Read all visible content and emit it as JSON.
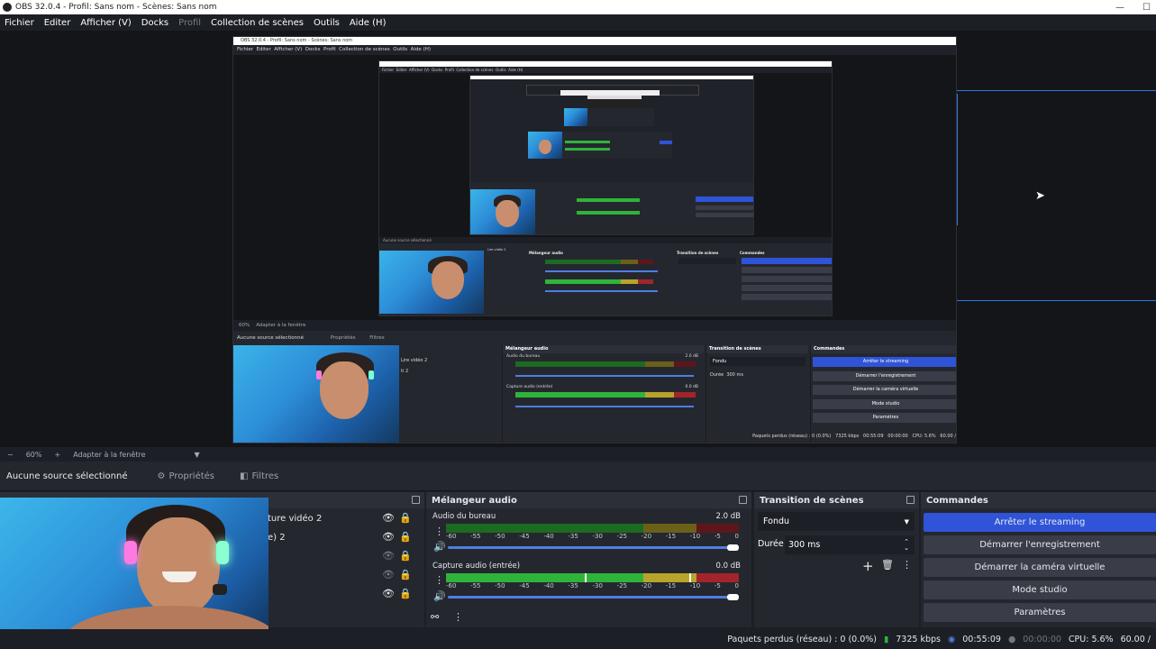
{
  "window": {
    "title": "OBS 32.0.4 - Profil: Sans nom - Scènes: Sans nom"
  },
  "menu": [
    "Fichier",
    "Editer",
    "Afficher (V)",
    "Docks",
    "Profil",
    "Collection de scènes",
    "Outils",
    "Aide (H)"
  ],
  "zoom": {
    "minus": "−",
    "value": "60%",
    "plus": "+",
    "fit": "Adapter à la fenêtre"
  },
  "source_bar": {
    "none_selected": "Aucune source sélectionné",
    "properties": "Propriétés",
    "filters": "Filtres"
  },
  "sources": {
    "items": [
      "ture vidéo 2",
      "e) 2"
    ]
  },
  "mixer": {
    "title": "Mélangeur audio",
    "ticks": [
      "-60",
      "-55",
      "-50",
      "-45",
      "-40",
      "-35",
      "-30",
      "-25",
      "-20",
      "-15",
      "-10",
      "-5",
      "0"
    ],
    "tracks": [
      {
        "name": "Audio du bureau",
        "db": "2.0 dB",
        "level": 0.0,
        "volume": 1.0
      },
      {
        "name": "Capture audio (entrée)",
        "db": "0.0 dB",
        "level": 0.9,
        "volume": 1.0
      }
    ]
  },
  "transition": {
    "title": "Transition de scènes",
    "selected": "Fondu",
    "duration_label": "Durée",
    "duration_value": "300 ms"
  },
  "commands": {
    "title": "Commandes",
    "buttons": [
      "Arrêter le streaming",
      "Démarrer l'enregistrement",
      "Démarrer la caméra virtuelle",
      "Mode studio",
      "Paramètres"
    ]
  },
  "status": {
    "dropped": "Paquets perdus (réseau) : 0 (0.0%)",
    "bitrate": "7325 kbps",
    "stream_time": "00:55:09",
    "rec_time": "00:00:00",
    "cpu": "CPU: 5.6%",
    "fps": "60.00 /"
  },
  "nested": {
    "title": "OBS 32.0.4 - Profil: Sans nom - Scènes: Sans nom",
    "menu": "Fichier  Editer  Afficher (V)  Docks  Profil  Collection de scènes  Outils  Aide (H)",
    "zoom": "60%    Adapter à la fenêtre",
    "no_source": "Aucune source sélectionné",
    "properties": "Propriétés",
    "filters": "Filtres",
    "src1": "Lire vidéo 2",
    "src2": "ti 2",
    "mixer": "Mélangeur audio",
    "desk": "Audio du bureau",
    "desk_db": "2.0 dB",
    "mic": "Capture audio (entrée)",
    "mic_db": "0.0 dB",
    "transition": "Transition de scènes",
    "fade": "Fondu",
    "duration": "Durée",
    "duration_value": "300 ms",
    "commands": "Commandes",
    "b1": "Arrêter le streaming",
    "b2": "Démarrer l'enregistrement",
    "b3": "Démarrer la caméra virtuelle",
    "b4": "Mode studio",
    "b5": "Paramètres",
    "status": "Paquets perdus (réseau) : 0 (0.0%)   7325 kbps   00:55:09   00:00:00   CPU: 5.6%   60.00 /"
  },
  "colors": {
    "accent": "#2f54d8",
    "meter_green": "#2fb43a",
    "meter_yellow": "#b8a42a",
    "meter_red": "#a3242c",
    "selection": "#2f7ad8"
  }
}
